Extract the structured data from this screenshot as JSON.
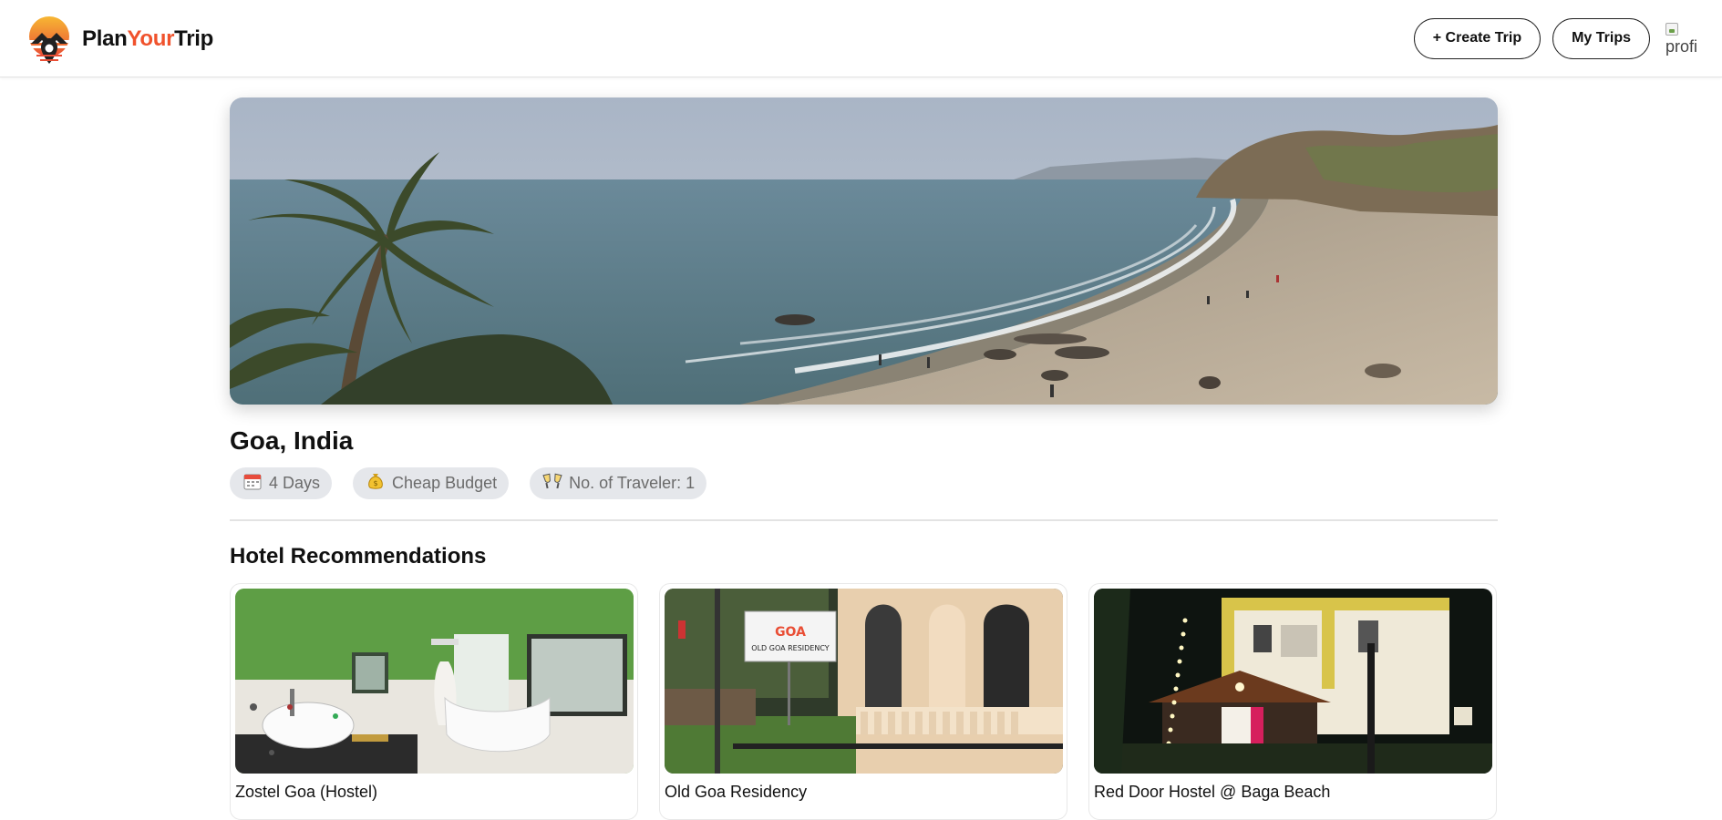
{
  "app": {
    "brand_prefix": "Plan",
    "brand_accent": "Your",
    "brand_suffix": "Trip",
    "accent_color": "#f0522c"
  },
  "nav": {
    "create_trip_label": "+ Create Trip",
    "my_trips_label": "My Trips",
    "profile_alt": "profile"
  },
  "trip": {
    "destination": "Goa, India",
    "chips": [
      {
        "icon": "calendar-icon",
        "label": "4 Days"
      },
      {
        "icon": "money-bag-icon",
        "label": "Cheap Budget"
      },
      {
        "icon": "cheers-icon",
        "label": "No. of Traveler: 1"
      }
    ]
  },
  "hotels_section": {
    "title": "Hotel Recommendations",
    "hotels": [
      {
        "name": "Zostel Goa (Hostel)"
      },
      {
        "name": "Old Goa Residency",
        "sign_text": "OLD GOA RESIDENCY"
      },
      {
        "name": "Red Door Hostel @ Baga Beach"
      }
    ]
  }
}
